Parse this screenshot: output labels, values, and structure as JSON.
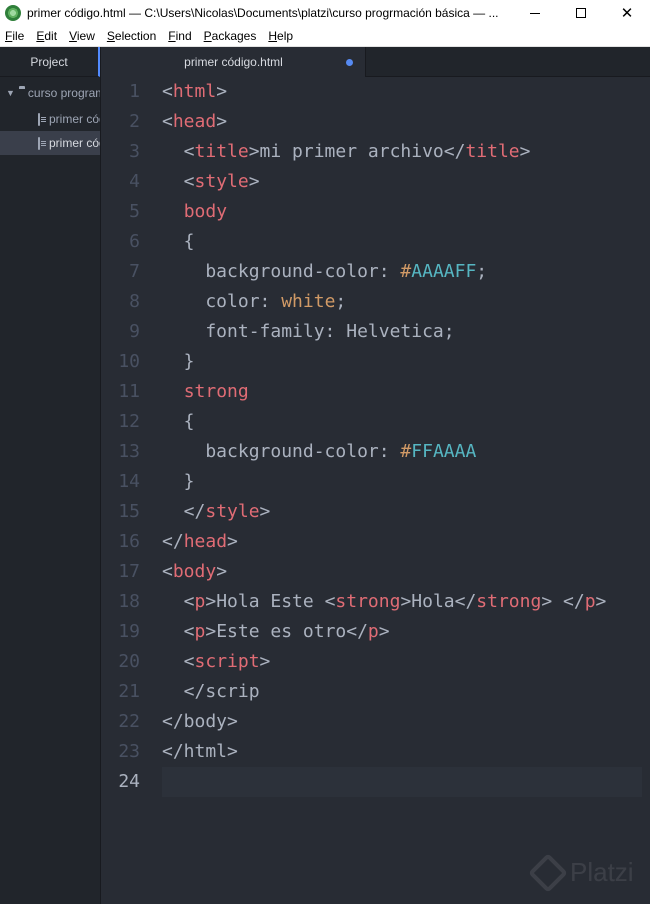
{
  "window": {
    "title": "primer código.html — C:\\Users\\Nicolas\\Documents\\platzi\\curso progrmación básica — ...",
    "icon": "atom-icon",
    "controls": {
      "minimize": "minimize-icon",
      "maximize": "maximize-icon",
      "close": "✕"
    }
  },
  "menu": [
    {
      "first": "F",
      "rest": "ile"
    },
    {
      "first": "E",
      "rest": "dit"
    },
    {
      "first": "V",
      "rest": "iew"
    },
    {
      "first": "S",
      "rest": "election"
    },
    {
      "first": "F",
      "rest": "ind"
    },
    {
      "first": "P",
      "rest": "ackages"
    },
    {
      "first": "H",
      "rest": "elp"
    }
  ],
  "sidebar": {
    "tab": "Project",
    "tree": [
      {
        "type": "folder",
        "label": "curso programación básica",
        "expanded": true
      },
      {
        "type": "file",
        "label": "primer código.html"
      },
      {
        "type": "file",
        "label": "primer código.html",
        "selected": true
      }
    ]
  },
  "tabs": [
    {
      "title": "primer código.html",
      "modified": true
    }
  ],
  "editor": {
    "current_line": 24,
    "lines": [
      {
        "n": "1",
        "tokens": [
          [
            "<",
            "punc"
          ],
          [
            "html",
            "tag"
          ],
          [
            ">",
            "punc"
          ]
        ]
      },
      {
        "n": "2",
        "tokens": [
          [
            "<",
            "punc"
          ],
          [
            "head",
            "tag"
          ],
          [
            ">",
            "punc"
          ]
        ]
      },
      {
        "n": "3",
        "tokens": [
          [
            "  <",
            "punc"
          ],
          [
            "title",
            "tag"
          ],
          [
            ">mi primer archivo</",
            "punc"
          ],
          [
            "title",
            "tag"
          ],
          [
            ">",
            "punc"
          ]
        ]
      },
      {
        "n": "4",
        "tokens": [
          [
            "  <",
            "punc"
          ],
          [
            "style",
            "tag"
          ],
          [
            ">",
            "punc"
          ]
        ]
      },
      {
        "n": "5",
        "tokens": [
          [
            "  ",
            "txt"
          ],
          [
            "body",
            "tag"
          ]
        ]
      },
      {
        "n": "6",
        "tokens": [
          [
            "  {",
            "punc"
          ]
        ]
      },
      {
        "n": "7",
        "tokens": [
          [
            "    background-color: ",
            "txt"
          ],
          [
            "#",
            "val"
          ],
          [
            "AAAAFF",
            "num"
          ],
          [
            ";",
            "punc"
          ]
        ]
      },
      {
        "n": "8",
        "tokens": [
          [
            "    color: ",
            "txt"
          ],
          [
            "white",
            "val"
          ],
          [
            ";",
            "punc"
          ]
        ]
      },
      {
        "n": "9",
        "tokens": [
          [
            "    font-family: Helvetica;",
            "txt"
          ]
        ]
      },
      {
        "n": "10",
        "tokens": [
          [
            "  }",
            "punc"
          ]
        ]
      },
      {
        "n": "11",
        "tokens": [
          [
            "  ",
            "txt"
          ],
          [
            "strong",
            "tag"
          ]
        ]
      },
      {
        "n": "12",
        "tokens": [
          [
            "  {",
            "punc"
          ]
        ]
      },
      {
        "n": "13",
        "tokens": [
          [
            "    background-color: ",
            "txt"
          ],
          [
            "#",
            "val"
          ],
          [
            "FFAAAA",
            "num"
          ]
        ]
      },
      {
        "n": "14",
        "tokens": [
          [
            "  }",
            "punc"
          ]
        ]
      },
      {
        "n": "15",
        "tokens": [
          [
            "  </",
            "punc"
          ],
          [
            "style",
            "tag"
          ],
          [
            ">",
            "punc"
          ]
        ]
      },
      {
        "n": "16",
        "tokens": [
          [
            "</",
            "punc"
          ],
          [
            "head",
            "tag"
          ],
          [
            ">",
            "punc"
          ]
        ]
      },
      {
        "n": "17",
        "tokens": [
          [
            "<",
            "punc"
          ],
          [
            "body",
            "tag"
          ],
          [
            ">",
            "punc"
          ]
        ]
      },
      {
        "n": "18",
        "tokens": [
          [
            "  <",
            "punc"
          ],
          [
            "p",
            "tag"
          ],
          [
            ">Hola Este <",
            "punc"
          ],
          [
            "strong",
            "tag"
          ],
          [
            ">Hola</",
            "punc"
          ],
          [
            "strong",
            "tag"
          ],
          [
            "> </",
            "punc"
          ],
          [
            "p",
            "tag"
          ],
          [
            ">",
            "punc"
          ]
        ]
      },
      {
        "n": "19",
        "tokens": [
          [
            "  <",
            "punc"
          ],
          [
            "p",
            "tag"
          ],
          [
            ">Este es otro</",
            "punc"
          ],
          [
            "p",
            "tag"
          ],
          [
            ">",
            "punc"
          ]
        ]
      },
      {
        "n": "20",
        "tokens": [
          [
            "  <",
            "punc"
          ],
          [
            "script",
            "tag"
          ],
          [
            ">",
            "punc"
          ]
        ]
      },
      {
        "n": "21",
        "tokens": [
          [
            "  </scrip",
            "txt"
          ]
        ]
      },
      {
        "n": "22",
        "tokens": [
          [
            "</body>",
            "txt"
          ]
        ]
      },
      {
        "n": "23",
        "tokens": [
          [
            "</html>",
            "txt"
          ]
        ]
      },
      {
        "n": "24",
        "tokens": []
      }
    ]
  },
  "colors": {
    "tag": "#e06c75",
    "text": "#abb2bf",
    "number": "#56b6c2",
    "value": "#d19a66",
    "background": "#282c34",
    "sidebar": "#21252b",
    "accent": "#568af2"
  },
  "watermark": {
    "text": "Platzi",
    "icon": "platzi-logo-icon"
  }
}
